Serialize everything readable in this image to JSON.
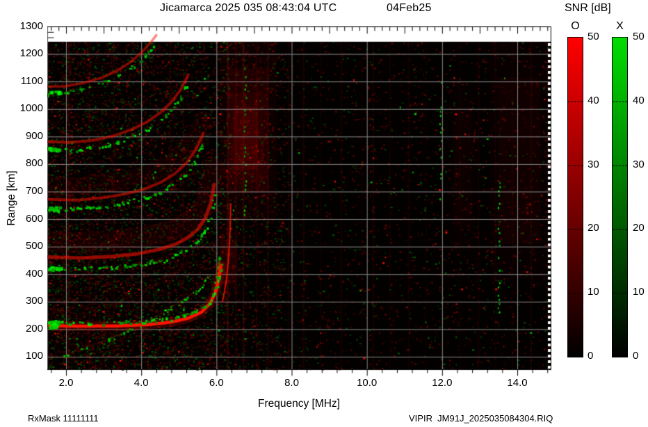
{
  "header": {
    "title": "Jicamarca 2025 035 08:43:04 UTC",
    "date": "04Feb25"
  },
  "footer": {
    "rx_mask": "RxMask 11111111",
    "file_label": "VIPIR  JM91J_2025035084304.RIQ"
  },
  "axes": {
    "x_label": "Frequency [MHz]",
    "y_label": "Range [km]",
    "x_ticks": [
      "2.0",
      "4.0",
      "6.0",
      "8.0",
      "10.0",
      "12.0",
      "14.0"
    ],
    "x_tick_values": [
      2,
      4,
      6,
      8,
      10,
      12,
      14
    ],
    "y_ticks": [
      "1300",
      "1200",
      "1100",
      "1000",
      "900",
      "800",
      "700",
      "600",
      "500",
      "400",
      "300",
      "200",
      "100"
    ],
    "y_tick_values": [
      1300,
      1200,
      1100,
      1000,
      900,
      800,
      700,
      600,
      500,
      400,
      300,
      200,
      100
    ]
  },
  "colorbar": {
    "title": "SNR [dB]",
    "o_label": "O",
    "x_label": "X",
    "o_color": "#ff0000",
    "x_color": "#00dd00",
    "ticks": [
      "50",
      "40",
      "30",
      "20",
      "10",
      "0"
    ],
    "tick_values": [
      50,
      40,
      30,
      20,
      10,
      0
    ],
    "min": 0,
    "max": 50
  },
  "chart_data": {
    "type": "heatmap",
    "title": "Jicamarca 2025 035 08:43:04 UTC 04Feb25",
    "xlabel": "Frequency [MHz]",
    "ylabel": "Range [km]",
    "xlim": [
      1.5,
      14.9
    ],
    "ylim": [
      52,
      1300
    ],
    "grid": true,
    "grid_color": "#8a8a8a",
    "background": "#030000",
    "legend": "Two SNR colorbars 0-50 dB: O-mode red, X-mode green",
    "traces": [
      {
        "name": "F-multiple-5",
        "mode": "both",
        "points": [
          [
            1.5,
            1062
          ],
          [
            1.95,
            1062
          ],
          [
            2.45,
            1074
          ],
          [
            2.95,
            1094
          ],
          [
            3.35,
            1119
          ],
          [
            3.7,
            1149
          ],
          [
            4.0,
            1184
          ],
          [
            4.25,
            1222
          ],
          [
            4.4,
            1248
          ]
        ],
        "red": {
          "w": 3.5,
          "a": 0.5,
          "off": 20
        },
        "green": {
          "prob": 0.4,
          "size": 3,
          "off": 0
        }
      },
      {
        "name": "F-multiple-4",
        "mode": "both",
        "points": [
          [
            1.5,
            857
          ],
          [
            2.1,
            853
          ],
          [
            2.75,
            862
          ],
          [
            3.3,
            879
          ],
          [
            3.75,
            901
          ],
          [
            4.15,
            928
          ],
          [
            4.5,
            961
          ],
          [
            4.8,
            1000
          ],
          [
            5.05,
            1046
          ],
          [
            5.25,
            1100
          ]
        ],
        "red": {
          "w": 4,
          "a": 0.5,
          "off": 25
        },
        "green": {
          "prob": 0.45,
          "size": 3,
          "off": 0
        }
      },
      {
        "name": "F-multiple-3",
        "mode": "both",
        "points": [
          [
            1.5,
            642
          ],
          [
            2.3,
            639
          ],
          [
            3.0,
            648
          ],
          [
            3.6,
            662
          ],
          [
            4.15,
            682
          ],
          [
            4.55,
            706
          ],
          [
            4.9,
            736
          ],
          [
            5.2,
            774
          ],
          [
            5.45,
            822
          ],
          [
            5.65,
            882
          ]
        ],
        "red": {
          "w": 4,
          "a": 0.5,
          "off": 30
        },
        "green": {
          "prob": 0.45,
          "size": 3,
          "off": 0
        },
        "haze": {
          "w": 26,
          "a": 0.08,
          "off": 80
        }
      },
      {
        "name": "F-multiple-2",
        "mode": "both",
        "points": [
          [
            1.5,
            424
          ],
          [
            2.4,
            421
          ],
          [
            3.2,
            426
          ],
          [
            3.9,
            436
          ],
          [
            4.45,
            451
          ],
          [
            4.9,
            470
          ],
          [
            5.2,
            492
          ],
          [
            5.5,
            524
          ],
          [
            5.7,
            565
          ],
          [
            5.85,
            620
          ],
          [
            5.94,
            688
          ]
        ],
        "red": {
          "w": 5,
          "a": 0.55,
          "off": 38
        },
        "green": {
          "prob": 0.5,
          "size": 3,
          "off": 0
        },
        "haze": {
          "w": 30,
          "a": 0.1,
          "off": 95
        }
      },
      {
        "name": "oblique-echo",
        "mode": "x",
        "points": [
          [
            1.85,
            100
          ],
          [
            2.4,
            128
          ],
          [
            3.0,
            158
          ],
          [
            3.6,
            192
          ],
          [
            4.1,
            226
          ],
          [
            4.6,
            262
          ],
          [
            5.0,
            298
          ],
          [
            5.35,
            330
          ],
          [
            5.6,
            360
          ],
          [
            5.8,
            396
          ]
        ],
        "red": {
          "w": 2,
          "a": 0.15,
          "off": 0
        },
        "green": {
          "prob": 0.3,
          "size": 2.6,
          "off": 0
        }
      },
      {
        "name": "F1-X-rise",
        "mode": "x",
        "points": [
          [
            5.93,
            345
          ],
          [
            5.99,
            390
          ],
          [
            6.04,
            435
          ],
          [
            6.08,
            475
          ]
        ],
        "green": {
          "prob": 0.8,
          "size": 3.4,
          "off": 0
        }
      },
      {
        "name": "F1-O-rise",
        "mode": "o",
        "points": [
          [
            6.16,
            300
          ],
          [
            6.25,
            365
          ],
          [
            6.31,
            440
          ],
          [
            6.35,
            520
          ],
          [
            6.37,
            610
          ],
          [
            6.38,
            655
          ]
        ],
        "red": {
          "w": 2,
          "a": 0.8,
          "off": 0
        }
      },
      {
        "name": "F1-main",
        "mode": "both",
        "points": [
          [
            1.5,
            213
          ],
          [
            2.4,
            211
          ],
          [
            3.4,
            212
          ],
          [
            4.2,
            217
          ],
          [
            4.8,
            226
          ],
          [
            5.25,
            240
          ],
          [
            5.6,
            262
          ],
          [
            5.82,
            292
          ],
          [
            5.97,
            333
          ],
          [
            6.06,
            382
          ],
          [
            6.12,
            432
          ]
        ],
        "red": {
          "w": 4.5,
          "a": 1,
          "off": 0,
          "glow": true
        },
        "green": {
          "prob": 0.5,
          "size": 3.2,
          "off": 14
        },
        "edge_blob": true
      }
    ],
    "rfi_streaks_red": [
      {
        "f": 2.05,
        "alpha": 0.16
      },
      {
        "f": 2.6,
        "alpha": 0.1
      },
      {
        "f": 3.25,
        "alpha": 0.09
      },
      {
        "f": 4.75,
        "alpha": 0.11
      },
      {
        "f": 5.1,
        "alpha": 0.09
      },
      {
        "f": 6.28,
        "alpha": 0.22
      },
      {
        "f": 6.5,
        "alpha": 0.13
      },
      {
        "f": 6.7,
        "alpha": 0.18
      },
      {
        "f": 7.05,
        "alpha": 0.11
      },
      {
        "f": 7.35,
        "alpha": 0.15
      },
      {
        "f": 7.9,
        "alpha": 0.09
      },
      {
        "f": 8.3,
        "alpha": 0.11
      },
      {
        "f": 8.75,
        "alpha": 0.07
      },
      {
        "f": 9.3,
        "alpha": 0.09
      },
      {
        "f": 9.85,
        "alpha": 0.06
      },
      {
        "f": 10.15,
        "alpha": 0.11
      },
      {
        "f": 10.6,
        "alpha": 0.07
      },
      {
        "f": 11.1,
        "alpha": 0.09
      },
      {
        "f": 11.55,
        "alpha": 0.06
      },
      {
        "f": 12.0,
        "alpha": 0.08
      },
      {
        "f": 12.45,
        "alpha": 0.06
      },
      {
        "f": 12.95,
        "alpha": 0.09
      },
      {
        "f": 13.4,
        "alpha": 0.06
      },
      {
        "f": 13.85,
        "alpha": 0.07
      },
      {
        "f": 14.35,
        "alpha": 0.08
      }
    ],
    "rfi_streaks_green": [
      {
        "f": 6.75,
        "r0": 600,
        "r1": 1150
      },
      {
        "f": 11.95,
        "r0": 650,
        "r1": 1100
      },
      {
        "f": 13.5,
        "r0": 250,
        "r1": 750
      }
    ],
    "haze_patches": [
      {
        "f0": 6.1,
        "f1": 7.6,
        "r0": 600,
        "r1": 1245,
        "alpha": 0.1
      },
      {
        "f0": 6.3,
        "f1": 7.25,
        "r0": 730,
        "r1": 1060,
        "alpha": 0.12
      },
      {
        "f0": 6.02,
        "f1": 6.6,
        "r0": 330,
        "r1": 560,
        "alpha": 0.1
      },
      {
        "f0": 13.25,
        "f1": 14.85,
        "r0": 380,
        "r1": 1245,
        "alpha": 0.05
      },
      {
        "f0": 12.2,
        "f1": 12.9,
        "r0": 480,
        "r1": 1100,
        "alpha": 0.04
      }
    ],
    "noise": {
      "seed": 1234567,
      "cell": 3,
      "dense_band_max_mhz": 6.3,
      "mid_band_max_mhz": 7.8,
      "dense_density": 0.42,
      "mid_density": 0.2,
      "sparse_density": 0.085,
      "green_fraction": 0.3
    }
  }
}
